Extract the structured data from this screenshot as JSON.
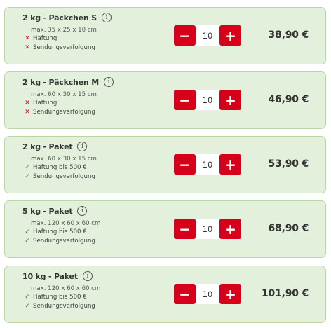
{
  "products": [
    {
      "title": "2 kg - Päckchen S",
      "dimensions": "max. 35 x 25 x 10 cm",
      "features": [
        {
          "label": "Haftung",
          "included": false
        },
        {
          "label": "Sendungsverfolgung",
          "included": false
        }
      ],
      "quantity": "10",
      "price": "38,90 €"
    },
    {
      "title": "2 kg - Päckchen M",
      "dimensions": "max. 60 x 30 x 15 cm",
      "features": [
        {
          "label": "Haftung",
          "included": false
        },
        {
          "label": "Sendungsverfolgung",
          "included": false
        }
      ],
      "quantity": "10",
      "price": "46,90 €"
    },
    {
      "title": "2 kg - Paket",
      "dimensions": "max. 60 x 30 x 15 cm",
      "features": [
        {
          "label": "Haftung bis 500 €",
          "included": true
        },
        {
          "label": "Sendungsverfolgung",
          "included": true
        }
      ],
      "quantity": "10",
      "price": "53,90 €"
    },
    {
      "title": "5 kg - Paket",
      "dimensions": "max. 120 x 60 x 60 cm",
      "features": [
        {
          "label": "Haftung bis 500 €",
          "included": true
        },
        {
          "label": "Sendungsverfolgung",
          "included": true
        }
      ],
      "quantity": "10",
      "price": "68,90 €"
    },
    {
      "title": "10 kg - Paket",
      "dimensions": "max. 120 x 60 x 60 cm",
      "features": [
        {
          "label": "Haftung bis 500 €",
          "included": true
        },
        {
          "label": "Sendungsverfolgung",
          "included": true
        }
      ],
      "quantity": "10",
      "price": "101,90 €"
    }
  ],
  "icons": {
    "info": "i",
    "minus": "−",
    "plus": "+",
    "included": "✓",
    "excluded": "✕"
  },
  "colors": {
    "accent": "#d7001b",
    "card_background": "#e3f0db",
    "card_border": "#b9d8a8",
    "check": "#2e8b2e"
  }
}
